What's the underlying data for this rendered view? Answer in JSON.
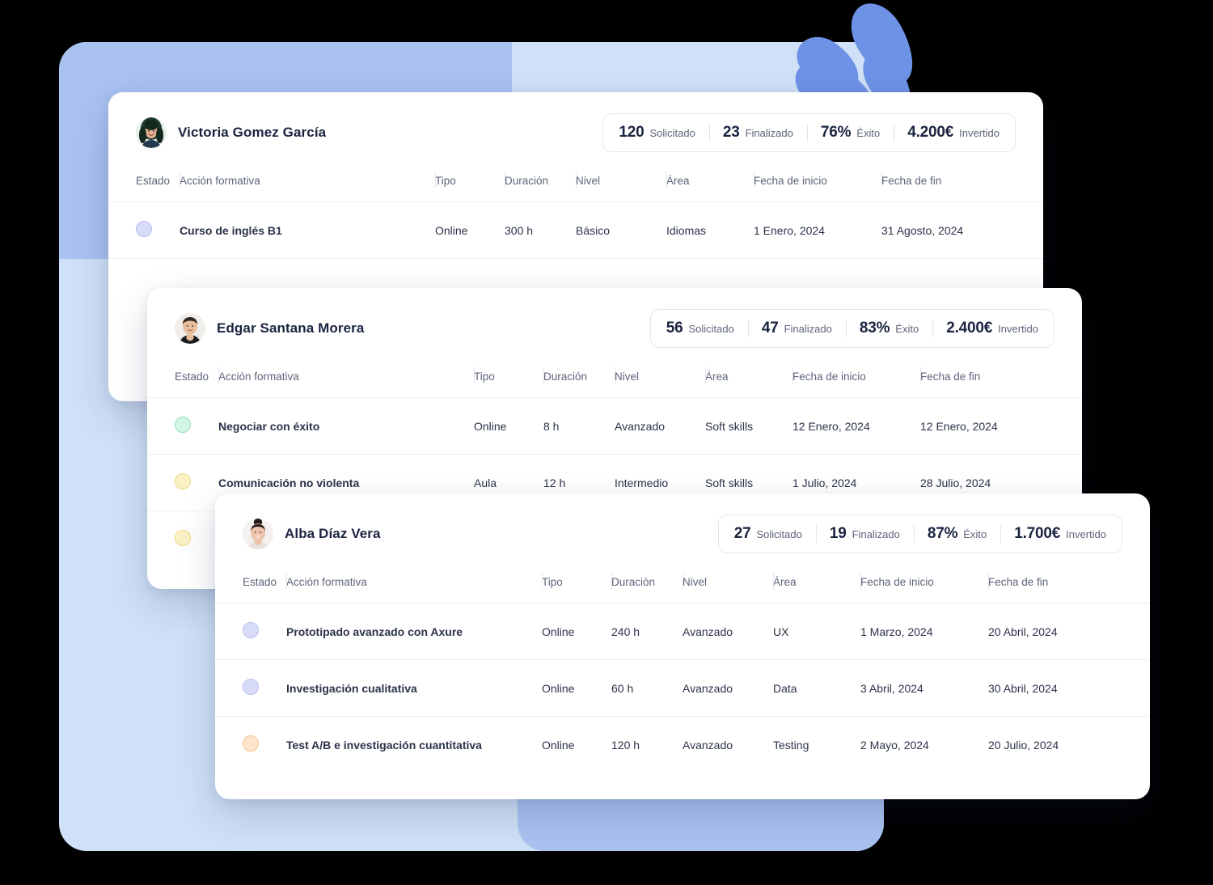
{
  "columns": {
    "estado": "Estado",
    "accion": "Acción formativa",
    "tipo": "Tipo",
    "duracion": "Duración",
    "nivel": "Nivel",
    "area": "Área",
    "fecha_inicio": "Fecha de inicio",
    "fecha_fin": "Fecha de fin"
  },
  "stat_labels": {
    "solicitado": "Solicitado",
    "finalizado": "Finalizado",
    "exito": "Éxito",
    "invertido": "Invertido"
  },
  "colors": {
    "background_panel": "#cfe0f7",
    "background_blob": "#a9c2f0",
    "petal": "#6e92e6",
    "card": "#ffffff",
    "text_primary": "#1b2440",
    "text_secondary": "#5d6579",
    "status_blue": "#d9dcf7",
    "status_green": "#d3f5e4",
    "status_amber": "#fbf1c6",
    "status_orange": "#fde6cd"
  },
  "cards": [
    {
      "id": "victoria",
      "user": {
        "name": "Victoria Gomez García",
        "avatar": "avatar-woman-dark-hair"
      },
      "stats": {
        "solicitado": "120",
        "finalizado": "23",
        "exito": "76%",
        "invertido": "4.200€"
      },
      "rows": [
        {
          "status": "blue",
          "accion": "Curso de inglés B1",
          "tipo": "Online",
          "duracion": "300 h",
          "nivel": "Básico",
          "area": "Idiomas",
          "fecha_inicio": "1 Enero, 2024",
          "fecha_fin": "31 Agosto, 2024"
        }
      ]
    },
    {
      "id": "edgar",
      "user": {
        "name": "Edgar Santana Morera",
        "avatar": "avatar-man-short-hair"
      },
      "stats": {
        "solicitado": "56",
        "finalizado": "47",
        "exito": "83%",
        "invertido": "2.400€"
      },
      "rows": [
        {
          "status": "green",
          "accion": "Negociar con éxito",
          "tipo": "Online",
          "duracion": "8 h",
          "nivel": "Avanzado",
          "area": "Soft skills",
          "fecha_inicio": "12 Enero, 2024",
          "fecha_fin": "12 Enero, 2024"
        },
        {
          "status": "amber",
          "accion": "Comunicación no violenta",
          "tipo": "Aula",
          "duracion": "12 h",
          "nivel": "Intermedio",
          "area": "Soft skills",
          "fecha_inicio": "1 Julio, 2024",
          "fecha_fin": "28 Julio, 2024"
        },
        {
          "status": "amber",
          "accion": "",
          "tipo": "",
          "duracion": "",
          "nivel": "",
          "area": "",
          "fecha_inicio": "",
          "fecha_fin": ""
        }
      ]
    },
    {
      "id": "alba",
      "user": {
        "name": "Alba Díaz Vera",
        "avatar": "avatar-woman-bun"
      },
      "stats": {
        "solicitado": "27",
        "finalizado": "19",
        "exito": "87%",
        "invertido": "1.700€"
      },
      "rows": [
        {
          "status": "blue",
          "accion": "Prototipado avanzado con Axure",
          "tipo": "Online",
          "duracion": "240 h",
          "nivel": "Avanzado",
          "area": "UX",
          "fecha_inicio": "1 Marzo, 2024",
          "fecha_fin": "20 Abril, 2024"
        },
        {
          "status": "blue",
          "accion": "Investigación cualitativa",
          "tipo": "Online",
          "duracion": "60 h",
          "nivel": "Avanzado",
          "area": "Data",
          "fecha_inicio": "3 Abril, 2024",
          "fecha_fin": "30 Abril, 2024"
        },
        {
          "status": "orange",
          "accion": "Test A/B e investigación cuantitativa",
          "tipo": "Online",
          "duracion": "120 h",
          "nivel": "Avanzado",
          "area": "Testing",
          "fecha_inicio": "2 Mayo, 2024",
          "fecha_fin": "20 Julio, 2024"
        }
      ]
    }
  ]
}
